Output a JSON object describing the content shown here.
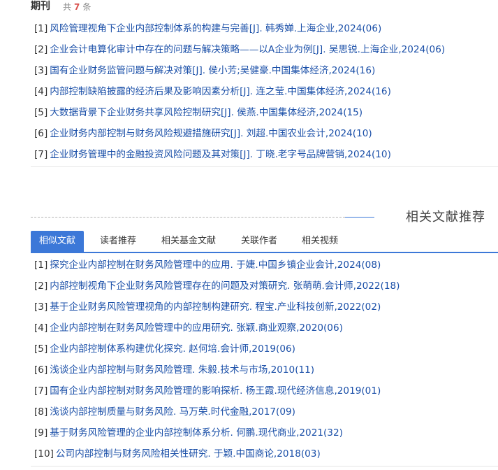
{
  "periodical": {
    "title": "期刊",
    "count_prefix": "共",
    "count": "7",
    "count_suffix": "条",
    "items": [
      {
        "index": "[1]",
        "text": "风险管理视角下企业内部控制体系的构建与完善[J]. 韩秀婵.上海企业,2024(06)"
      },
      {
        "index": "[2]",
        "text": "企业会计电算化审计中存在的问题与解决策略——以A企业为例[J]. 吴思锐.上海企业,2024(06)"
      },
      {
        "index": "[3]",
        "text": "国有企业财务监管问题与解决对策[J]. 侯小芳;吴健豪.中国集体经济,2024(16)"
      },
      {
        "index": "[4]",
        "text": "内部控制缺陷披露的经济后果及影响因素分析[J]. 连之莹.中国集体经济,2024(16)"
      },
      {
        "index": "[5]",
        "text": "大数据背景下企业财务共享风险控制研究[J]. 侯燕.中国集体经济,2024(15)"
      },
      {
        "index": "[6]",
        "text": "企业财务内部控制与财务风险规避措施研究[J]. 刘超.中国农业会计,2024(10)"
      },
      {
        "index": "[7]",
        "text": "企业财务管理中的金融投资风险问题及其对策[J]. 丁晓.老字号品牌营销,2024(10)"
      }
    ]
  },
  "related": {
    "section_title": "相关文献推荐",
    "tabs": [
      {
        "label": "相似文献",
        "active": true
      },
      {
        "label": "读者推荐",
        "active": false
      },
      {
        "label": "相关基金文献",
        "active": false
      },
      {
        "label": "关联作者",
        "active": false
      },
      {
        "label": "相关视频",
        "active": false
      }
    ],
    "items": [
      {
        "index": "[1]",
        "text": "探究企业内部控制在财务风险管理中的应用. 于婕.中国乡镇企业会计,2024(08)"
      },
      {
        "index": "[2]",
        "text": "内部控制视角下企业财务风险管理存在的问题及对策研究. 张萌萌.会计师,2022(18)"
      },
      {
        "index": "[3]",
        "text": "基于企业财务风险管理视角的内部控制构建研究. 程宝.产业科技创新,2022(02)"
      },
      {
        "index": "[4]",
        "text": "企业内部控制在财务风险管理中的应用研究. 张颖.商业观察,2020(06)"
      },
      {
        "index": "[5]",
        "text": "企业内部控制体系构建优化探究. 赵何培.会计师,2019(06)"
      },
      {
        "index": "[6]",
        "text": "浅谈企业内部控制与财务风险管理. 朱毅.技术与市场,2010(11)"
      },
      {
        "index": "[7]",
        "text": "国有企业内部控制对财务风险管理的影响探析. 杨王霞.现代经济信息,2019(01)"
      },
      {
        "index": "[8]",
        "text": "浅谈内部控制质量与财务风险. 马万荣.时代金融,2017(09)"
      },
      {
        "index": "[9]",
        "text": "基于财务风险管理的企业内部控制体系分析. 何鹏.现代商业,2021(32)"
      },
      {
        "index": "[10]",
        "text": "公司内部控制与财务风险相关性研究. 于颖.中国商论,2018(03)"
      }
    ]
  },
  "colors": {
    "link": "#1a4fa8",
    "accent": "#3c78d8",
    "count": "#d9534f"
  }
}
